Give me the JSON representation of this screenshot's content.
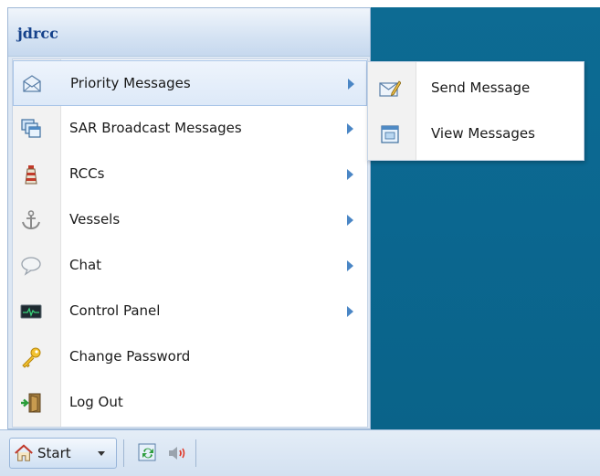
{
  "user": "jdrcc",
  "menu": {
    "items": [
      {
        "label": "Priority Messages",
        "icon": "envelope-icon",
        "has_submenu": true,
        "active": true
      },
      {
        "label": "SAR Broadcast Messages",
        "icon": "windows-stack-icon",
        "has_submenu": true
      },
      {
        "label": "RCCs",
        "icon": "lighthouse-icon",
        "has_submenu": true
      },
      {
        "label": "Vessels",
        "icon": "anchor-icon",
        "has_submenu": true
      },
      {
        "label": "Chat",
        "icon": "speech-bubble-icon",
        "has_submenu": true
      },
      {
        "label": "Control Panel",
        "icon": "monitor-icon",
        "has_submenu": true
      },
      {
        "label": "Change Password",
        "icon": "key-icon",
        "has_submenu": false
      },
      {
        "label": "Log Out",
        "icon": "door-exit-icon",
        "has_submenu": false
      }
    ]
  },
  "submenu": {
    "items": [
      {
        "label": "Send Message",
        "icon": "compose-envelope-icon"
      },
      {
        "label": "View Messages",
        "icon": "view-window-icon"
      }
    ]
  },
  "taskbar": {
    "start_label": "Start",
    "tray_icons": [
      "refresh-icon",
      "speaker-icon"
    ]
  },
  "colors": {
    "desktop": "#0b6790",
    "header_text": "#15428b",
    "submenu_arrow": "#4a86c5"
  }
}
